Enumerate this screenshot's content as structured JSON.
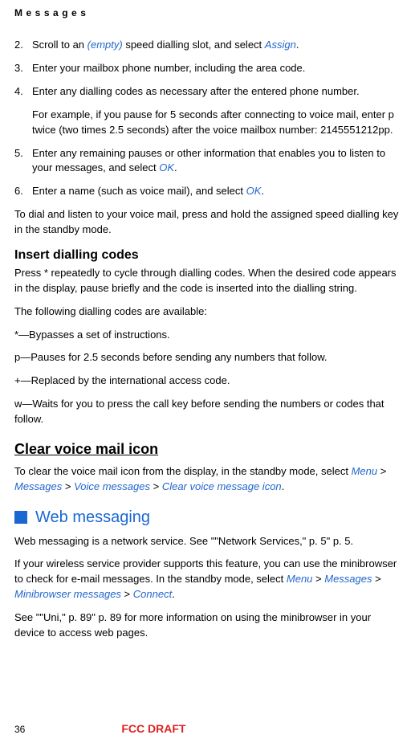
{
  "header": "Messages",
  "steps": {
    "s2": {
      "num": "2.",
      "pre": "Scroll to an ",
      "empty": "(empty)",
      "mid": " speed dialling slot, and select ",
      "assign": "Assign",
      "end": "."
    },
    "s3": {
      "num": "3.",
      "text": "Enter your mailbox phone number, including the area code."
    },
    "s4": {
      "num": "4.",
      "text": "Enter any dialling codes as necessary after the entered phone number."
    },
    "s4_detail": "For example, if you pause for 5 seconds after connecting to voice mail, enter p twice (two times 2.5 seconds) after the voice mailbox number: 2145551212pp.",
    "s5": {
      "num": "5.",
      "pre": "Enter any remaining pauses or other information that enables you to listen to your messages, and select ",
      "ok": "OK",
      "end": "."
    },
    "s6": {
      "num": "6.",
      "pre": "Enter a name (such as voice mail), and select ",
      "ok": "OK",
      "end": "."
    }
  },
  "dial_note": "To dial and listen to your voice mail, press and hold the assigned speed dialling key in the standby mode.",
  "insert_heading": "Insert dialling codes",
  "insert_intro": "Press * repeatedly to cycle through dialling codes. When the desired code appears in the display, pause briefly and the code is inserted into the dialling string.",
  "codes_avail": "The following dialling codes are available:",
  "code_star": "*—Bypasses a set of instructions.",
  "code_p": "p—Pauses for 2.5 seconds before sending any numbers that follow.",
  "code_plus": "+—Replaced by the international access code.",
  "code_w": "w—Waits for you to press the call key before sending the numbers or codes that follow.",
  "clear_heading": "Clear voice mail icon",
  "clear": {
    "pre": "To clear the voice mail icon from the display, in the standby mode, select ",
    "menu": "Menu",
    "gt1": " > ",
    "messages": "Messages",
    "gt2": " > ",
    "voice": "Voice messages",
    "gt3": " > ",
    "clearicon": "Clear voice message icon",
    "end": "."
  },
  "web_heading": "Web messaging",
  "web_intro": "Web messaging is a network service. See \"\"Network Services,\" p. 5\" p. 5.",
  "web_provider": {
    "pre": "If your wireless service provider supports this feature, you can use the minibrowser to check for e-mail messages. In the standby mode, select ",
    "menu": "Menu",
    "gt1": " > ",
    "messages": "Messages",
    "gt2": " > ",
    "mini": "Minibrowser messages",
    "gt3": " > ",
    "connect": "Connect",
    "end": "."
  },
  "web_see": "See \"\"Uni,\" p. 89\" p. 89 for more information on using the minibrowser in your device to access web pages.",
  "page_number": "36",
  "fcc": "FCC DRAFT"
}
